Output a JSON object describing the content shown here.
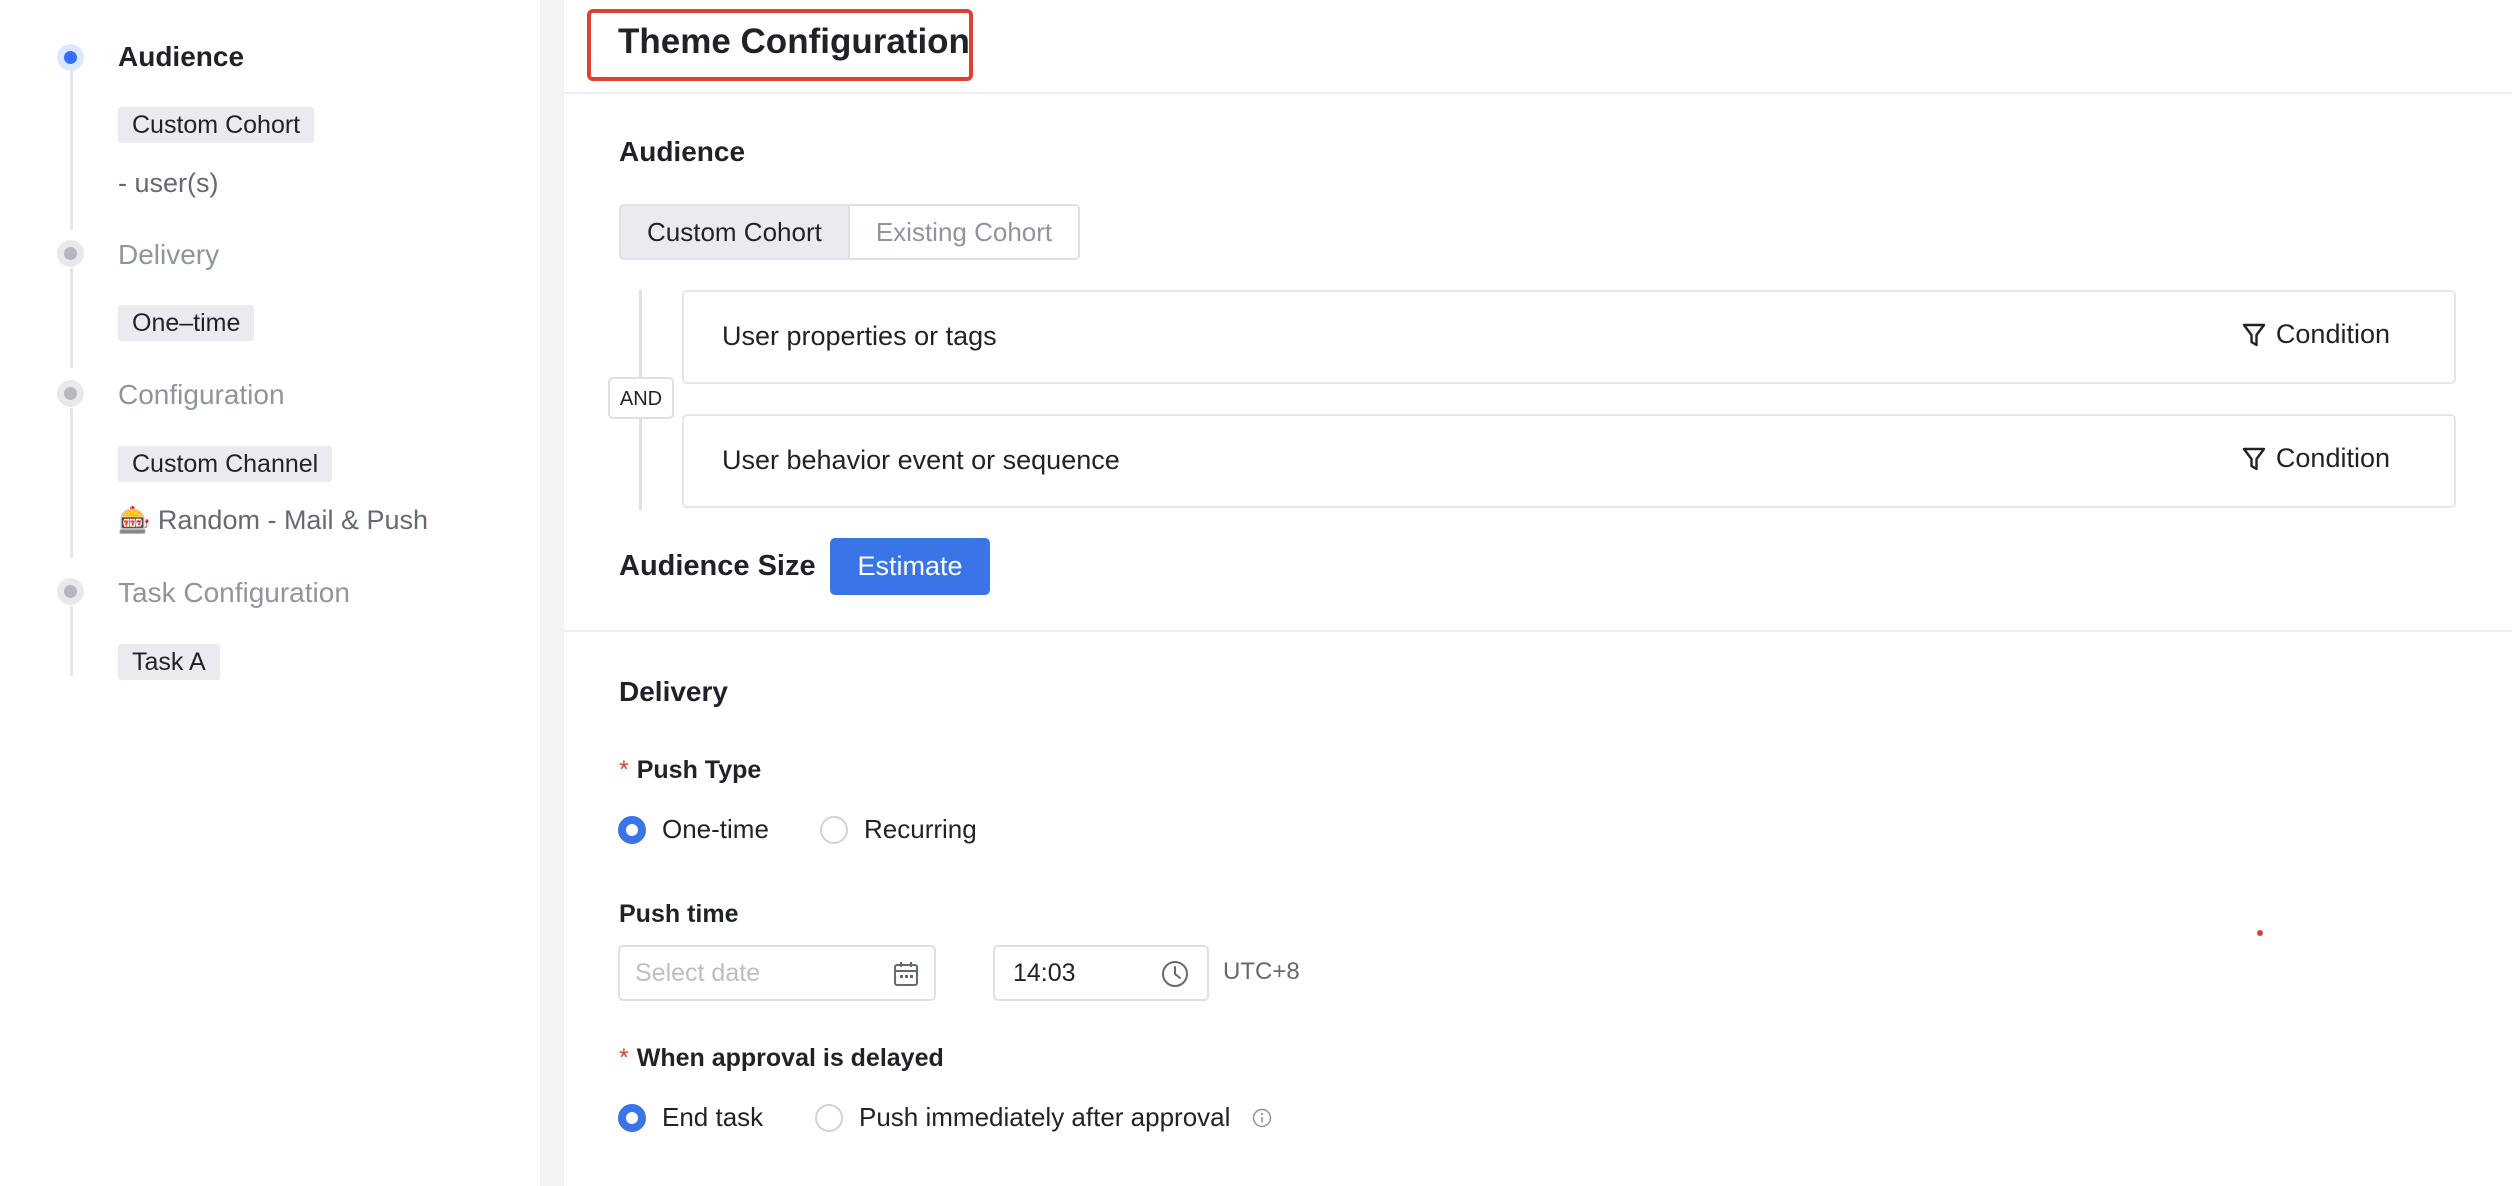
{
  "sidebar": {
    "steps": [
      {
        "title": "Audience",
        "chip": "Custom Cohort",
        "note": "- user(s)"
      },
      {
        "title": "Delivery",
        "chip": "One–time"
      },
      {
        "title": "Configuration",
        "chip": "Custom Channel",
        "note": "Random - Mail & Push",
        "note_icon": "slot-machine-icon"
      },
      {
        "title": "Task Configuration",
        "chip": "Task A"
      }
    ],
    "colors": {
      "active_dot": "#3370ff",
      "inactive_dot": "#b5b8bf"
    }
  },
  "header": {
    "title": "Theme Configuration",
    "highlight_color": "#e0412f"
  },
  "audience": {
    "section_title": "Audience",
    "tabs": [
      "Custom Cohort",
      "Existing Cohort"
    ],
    "selected_tab": "Custom Cohort",
    "logic_operator": "AND",
    "conditions": [
      {
        "label": "User properties or tags",
        "action": "Condition",
        "icon": "filter-icon"
      },
      {
        "label": "User behavior event or sequence",
        "action": "Condition",
        "icon": "filter-icon"
      }
    ],
    "size_label": "Audience Size",
    "estimate_button": "Estimate"
  },
  "delivery": {
    "section_title": "Delivery",
    "push_type": {
      "label": "Push Type",
      "required_mark": "*",
      "options": [
        "One-time",
        "Recurring"
      ],
      "selected": "One-time"
    },
    "push_time": {
      "label": "Push time",
      "date_placeholder": "Select date",
      "time_value": "14:03",
      "timezone": "UTC+8"
    },
    "approval": {
      "label": "When approval is delayed",
      "required_mark": "*",
      "options": [
        "End task",
        "Push immediately after approval"
      ],
      "selected": "End task",
      "info_icon": "info-icon"
    }
  },
  "colors": {
    "primary": "#3a75e8",
    "required": "#e0412f"
  }
}
